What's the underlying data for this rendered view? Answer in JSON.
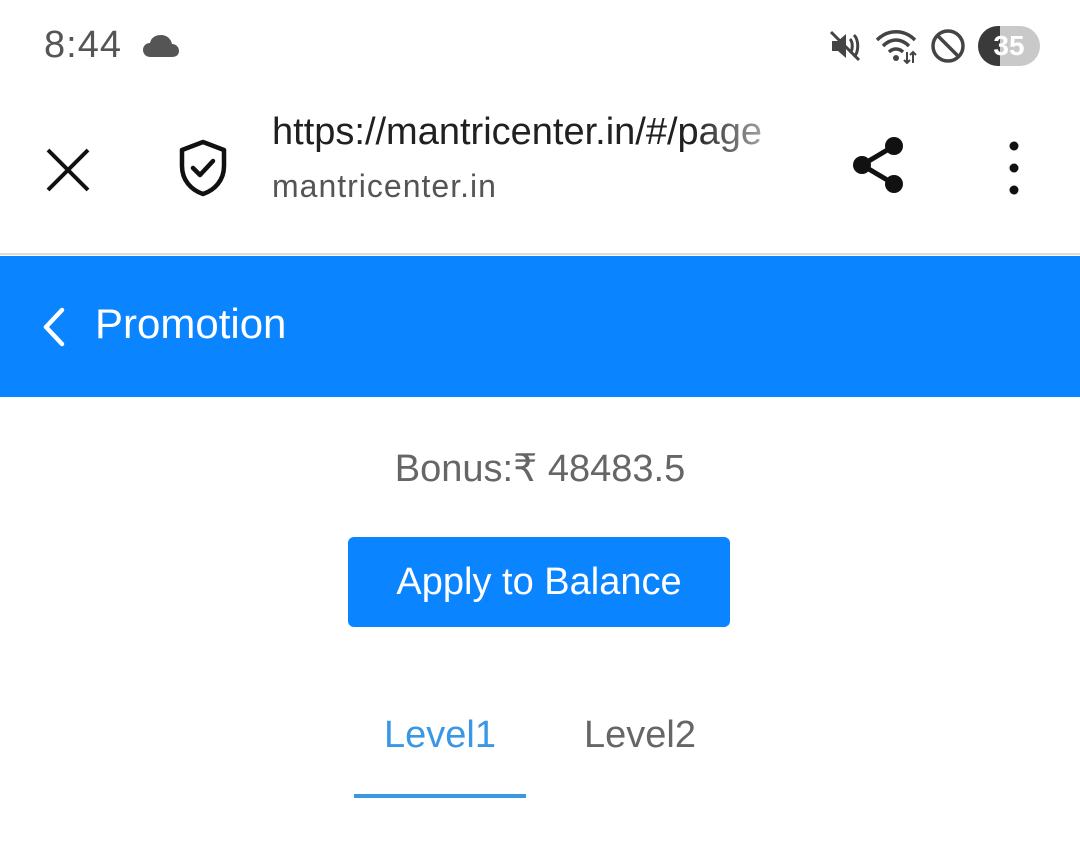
{
  "status_bar": {
    "time": "8:44",
    "battery": "35",
    "icons": [
      "cloud-icon",
      "mute-icon",
      "wifi-icon",
      "do-not-disturb-icon",
      "battery-icon"
    ]
  },
  "browser": {
    "url": "https://mantricenter.in/#/page",
    "domain": "mantricenter.in",
    "icons": [
      "close-icon",
      "shield-check-icon",
      "share-icon",
      "more-vert-icon"
    ]
  },
  "header": {
    "title": "Promotion",
    "color": "#0a84ff"
  },
  "bonus": {
    "label": "Bonus:₹ 48483.5"
  },
  "apply_button": {
    "label": "Apply to Balance"
  },
  "tabs": [
    {
      "label": "Level1",
      "active": true
    },
    {
      "label": "Level2",
      "active": false
    }
  ],
  "colors": {
    "accent": "#0a84ff",
    "active_tab": "#3a97e6"
  }
}
